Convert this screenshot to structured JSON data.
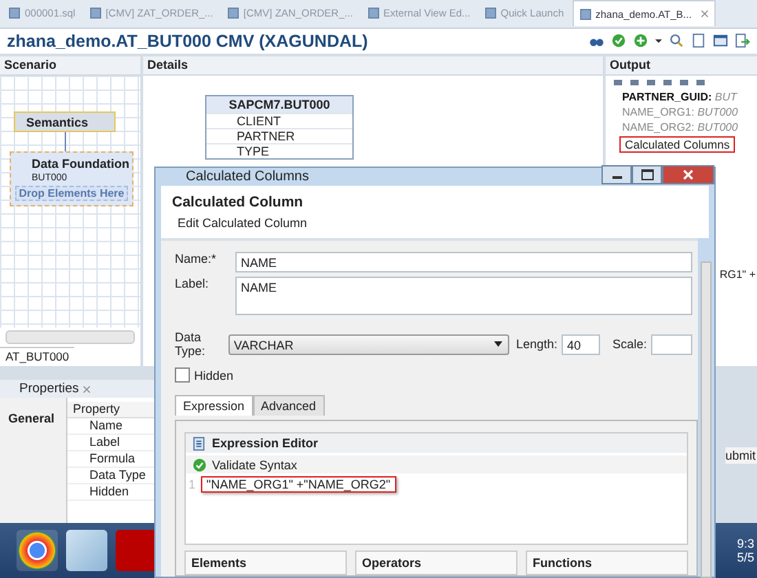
{
  "editor_tabs": [
    {
      "label": "000001.sql",
      "selected": false
    },
    {
      "label": "[CMV] ZAT_ORDER_...",
      "selected": false
    },
    {
      "label": "[CMV] ZAN_ORDER_...",
      "selected": false
    },
    {
      "label": "External View Ed...",
      "selected": false
    },
    {
      "label": "Quick Launch",
      "selected": false
    },
    {
      "label": "zhana_demo.AT_B...",
      "selected": true
    }
  ],
  "editor_title": "zhana_demo.AT_BUT000 CMV (XAGUNDAL)",
  "scenario": {
    "title": "Scenario",
    "semantics": "Semantics",
    "foundation": {
      "title": "Data Foundation",
      "table": "BUT000",
      "drop_hint": "Drop Elements Here"
    },
    "view_tab": "AT_BUT000"
  },
  "details": {
    "title": "Details",
    "table": {
      "name": "SAPCM7.BUT000",
      "columns": [
        "CLIENT",
        "PARTNER",
        "TYPE"
      ]
    }
  },
  "output": {
    "title": "Output",
    "items": [
      {
        "name": "PARTNER_GUID:",
        "source": "BUT",
        "kind": "key"
      },
      {
        "name": "NAME_ORG1:",
        "source": "BUT000",
        "kind": "attribute"
      },
      {
        "name": "NAME_ORG2:",
        "source": "BUT000",
        "kind": "attribute"
      }
    ],
    "folder": "Calculated Columns",
    "expression_fragment": "RG1\" +"
  },
  "properties": {
    "title": "Properties",
    "side_tab": "General",
    "column": "Property",
    "rows": [
      "Name",
      "Label",
      "Formula",
      "Data Type",
      "Hidden"
    ],
    "button_fragment": "ubmit"
  },
  "taskbar": {
    "clock": [
      "9:3",
      "5/5"
    ]
  },
  "dialog": {
    "window_title": "Calculated Columns",
    "title": "Calculated Column",
    "subtitle": "Edit Calculated Column",
    "name_label": "Name:*",
    "name": "NAME",
    "label_label": "Label:",
    "label": "NAME",
    "data_type_label": "Data Type:",
    "data_type": "VARCHAR",
    "length_label": "Length:",
    "length": "40",
    "scale_label": "Scale:",
    "hidden": {
      "label": "Hidden",
      "checked": false
    },
    "tabs": [
      {
        "label": "Expression",
        "selected": true
      },
      {
        "label": "Advanced",
        "selected": false
      }
    ],
    "expression_editor": {
      "title": "Expression Editor",
      "validate": "Validate Syntax",
      "lines": [
        {
          "number": "1",
          "text": "\"NAME_ORG1\" +\"NAME_ORG2\""
        }
      ]
    },
    "panes": [
      "Elements",
      "Operators",
      "Functions"
    ]
  }
}
